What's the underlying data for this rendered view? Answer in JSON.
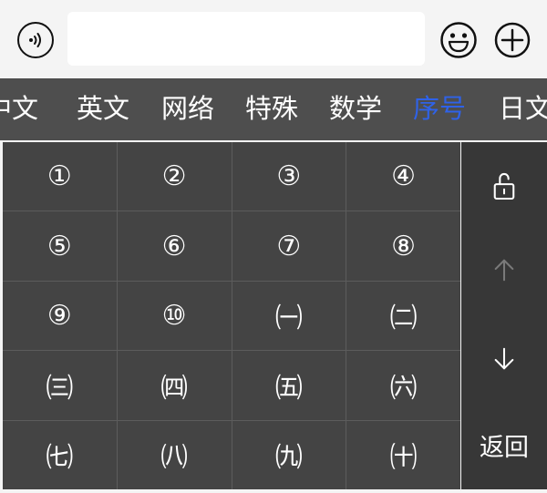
{
  "input_bar": {
    "voice_icon": "voice-input-icon",
    "text_value": "",
    "emoji_icon": "smiley-icon",
    "plus_icon": "plus-circle-icon"
  },
  "categories": [
    {
      "label": "中文",
      "active": false
    },
    {
      "label": "英文",
      "active": false
    },
    {
      "label": "网络",
      "active": false
    },
    {
      "label": "特殊",
      "active": false
    },
    {
      "label": "数学",
      "active": false
    },
    {
      "label": "序号",
      "active": true
    },
    {
      "label": "日文",
      "active": false
    }
  ],
  "keys": [
    "①",
    "②",
    "③",
    "④",
    "⑤",
    "⑥",
    "⑦",
    "⑧",
    "⑨",
    "⑩",
    "㈠",
    "㈡",
    "㈢",
    "㈣",
    "㈤",
    "㈥",
    "㈦",
    "㈧",
    "㈨",
    "㈩"
  ],
  "side_panel": {
    "lock_icon": "unlock-icon",
    "up_icon": "arrow-up-icon",
    "down_icon": "arrow-down-icon",
    "back_label": "返回"
  },
  "colors": {
    "accent": "#2f62e8",
    "key_bg": "#444444",
    "category_bg": "#4e4e4e",
    "side_bg": "#373737"
  }
}
